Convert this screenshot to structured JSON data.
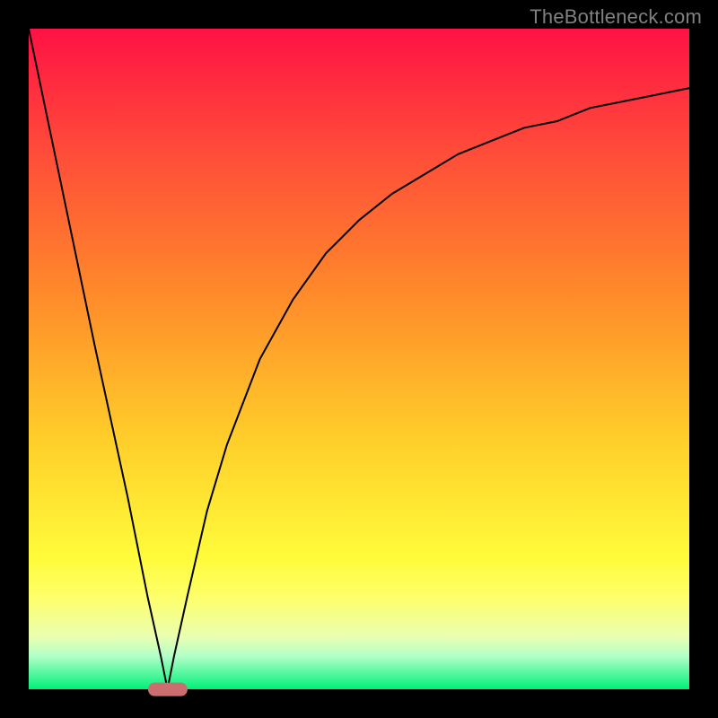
{
  "watermark": "TheBottleneck.com",
  "colors": {
    "frame": "#000000",
    "gradient_top": "#ff1244",
    "gradient_bottom": "#00f07a",
    "curve": "#000000",
    "marker": "#cc6d70",
    "watermark": "#808080"
  },
  "chart_data": {
    "type": "line",
    "title": "",
    "xlabel": "",
    "ylabel": "",
    "xlim": [
      0,
      100
    ],
    "ylim": [
      0,
      100
    ],
    "annotations": [],
    "marker": {
      "x": 21,
      "y": 0,
      "w": 6,
      "h": 2
    },
    "series": [
      {
        "name": "bottleneck-curve",
        "x": [
          0,
          5,
          10,
          15,
          18,
          20,
          21,
          22,
          24,
          27,
          30,
          35,
          40,
          45,
          50,
          55,
          60,
          65,
          70,
          75,
          80,
          85,
          90,
          95,
          100
        ],
        "values": [
          100,
          76,
          52,
          29,
          14,
          5,
          0,
          5,
          14,
          27,
          37,
          50,
          59,
          66,
          71,
          75,
          78,
          81,
          83,
          85,
          86,
          88,
          89,
          90,
          91
        ]
      }
    ]
  }
}
